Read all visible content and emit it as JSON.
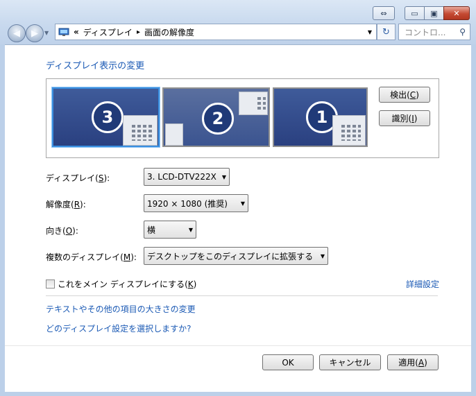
{
  "titlebar": {
    "swap_icon": "⇔",
    "min_icon": "▭",
    "max_icon": "▣",
    "close_icon": "✕"
  },
  "nav": {
    "back_icon": "◀",
    "forward_icon": "▶",
    "dropdown_icon": "▼",
    "breadcrumb_sep": "«",
    "crumbs": [
      "ディスプレイ",
      "画面の解像度"
    ],
    "crumb_arrow": "▸",
    "address_dropdown_icon": "▼",
    "refresh_icon": "↻",
    "search_placeholder": "コントロ...",
    "search_icon": "⚲"
  },
  "main": {
    "heading": "ディスプレイ表示の変更",
    "monitors": [
      "3",
      "2",
      "1"
    ],
    "detect_button": {
      "text": "検出(",
      "key": "C",
      "end": ")"
    },
    "identify_button": {
      "text": "識別(",
      "key": "I",
      "end": ")"
    },
    "fields": {
      "display": {
        "label": "ディスプレイ(",
        "key": "S",
        "end": "):",
        "value": "3. LCD-DTV222X"
      },
      "resolution": {
        "label": "解像度(",
        "key": "R",
        "end": "):",
        "value": "1920 × 1080 (推奨)"
      },
      "orientation": {
        "label": "向き(",
        "key": "O",
        "end": "):",
        "value": "横"
      },
      "multiple": {
        "label": "複数のディスプレイ(",
        "key": "M",
        "end": "):",
        "value": "デスクトップをこのディスプレイに拡張する"
      }
    },
    "make_main": {
      "text": "これをメイン ディスプレイにする(",
      "key": "K",
      "end": ")",
      "checked": false
    },
    "advanced_link": "詳細設定",
    "links": [
      "テキストやその他の項目の大きさの変更",
      "どのディスプレイ設定を選択しますか?"
    ],
    "buttons": {
      "ok": "OK",
      "cancel": "キャンセル",
      "apply": {
        "text": "適用(",
        "key": "A",
        "end": ")"
      }
    }
  },
  "colors": {
    "link": "#1a59b4",
    "monitor_fill": "#2a4080",
    "selected_border": "#3a8fe0",
    "close_button": "#c44a33"
  }
}
